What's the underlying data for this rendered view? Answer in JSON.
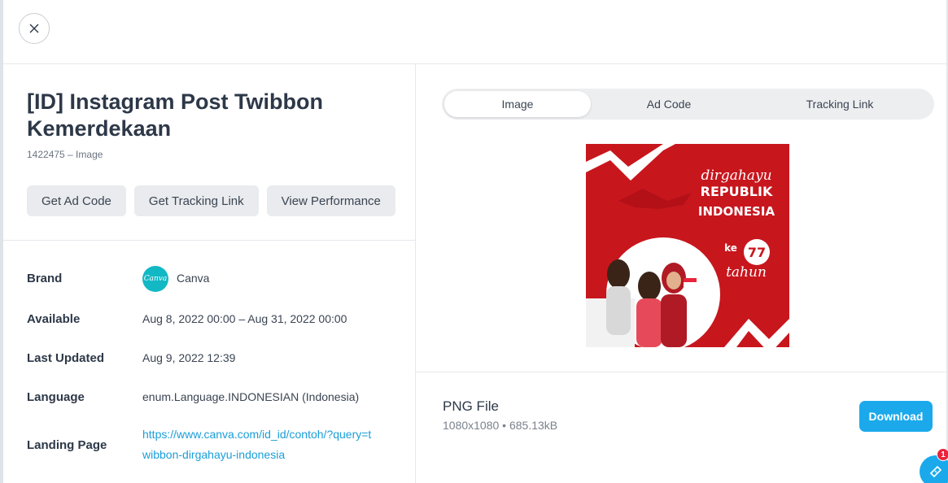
{
  "header": {
    "close_icon": "close-icon"
  },
  "ad": {
    "title": "[ID] Instagram Post Twibbon Kemerdekaan",
    "subtitle": "1422475 – Image",
    "actions": [
      "Get Ad Code",
      "Get Tracking Link",
      "View Performance"
    ]
  },
  "details": {
    "brand": {
      "label": "Brand",
      "value": "Canva",
      "logo_text": "Canva"
    },
    "available": {
      "label": "Available",
      "value": "Aug 8, 2022 00:00 – Aug 31, 2022 00:00"
    },
    "last_updated": {
      "label": "Last Updated",
      "value": "Aug 9, 2022 12:39"
    },
    "language": {
      "label": "Language",
      "value": "enum.Language.INDONESIAN (Indonesia)"
    },
    "landing_page": {
      "label": "Landing Page",
      "value": "https://www.canva.com/id_id/contoh/?query=twibbon-dirgahayu-indonesia"
    }
  },
  "tabs": [
    {
      "label": "Image",
      "active": true
    },
    {
      "label": "Ad Code",
      "active": false
    },
    {
      "label": "Tracking Link",
      "active": false
    }
  ],
  "preview": {
    "line1": "dirgahayu",
    "line2": "REPUBLIK",
    "line3": "INDONESIA",
    "line4": "ke",
    "line5": "77",
    "line6": "tahun"
  },
  "file": {
    "type": "PNG File",
    "meta": "1080x1080 • 685.13kB",
    "download_label": "Download"
  },
  "floating": {
    "badge_count": "1",
    "icon": "ticket-icon"
  },
  "colors": {
    "accent": "#1ba9ec",
    "link": "#1a9ed8",
    "badge": "#e8253b",
    "brand_logo": "#13b8c5",
    "preview_red": "#c8161d"
  }
}
